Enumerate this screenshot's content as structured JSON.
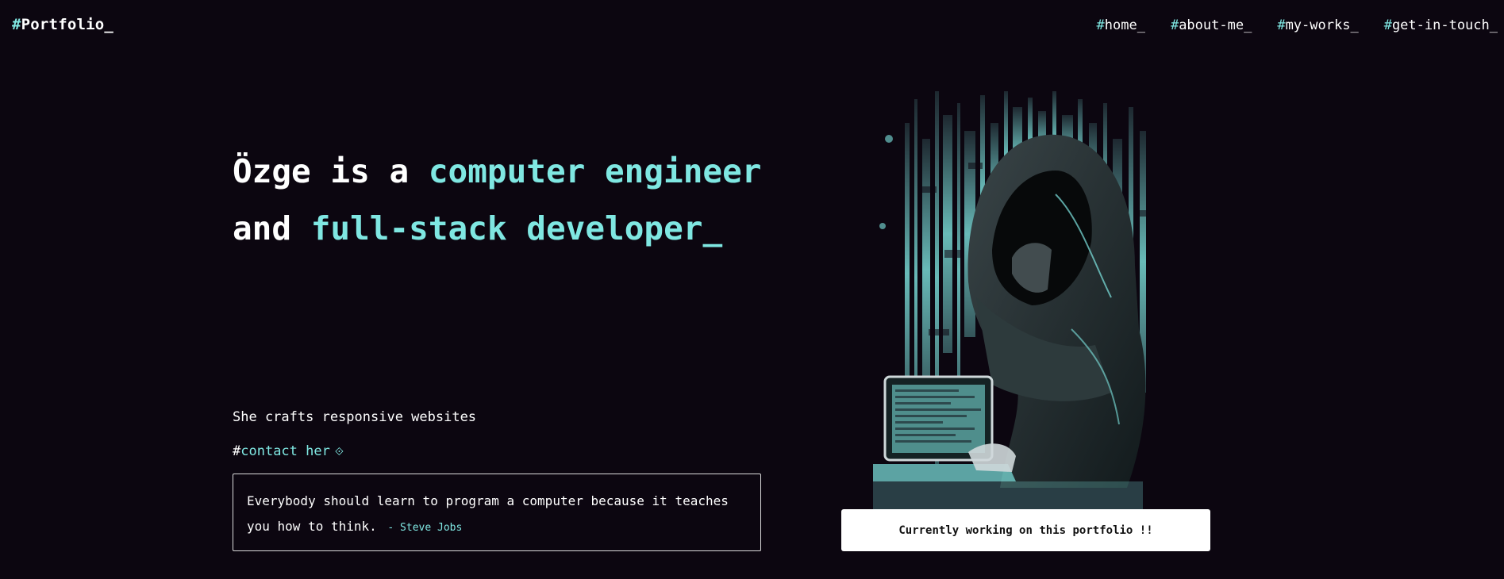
{
  "header": {
    "logo": {
      "hash": "#",
      "text": "Portfolio_"
    },
    "nav": [
      {
        "hash": "#",
        "label": "home_"
      },
      {
        "hash": "#",
        "label": "about-me_"
      },
      {
        "hash": "#",
        "label": "my-works_"
      },
      {
        "hash": "#",
        "label": "get-in-touch_"
      }
    ]
  },
  "hero": {
    "line1_plain": "Özge is a ",
    "line1_accent": "computer engineer",
    "line2_plain": "and ",
    "line2_accent": "full-stack developer",
    "line2_suffix": "_",
    "tagline": "She crafts responsive websites",
    "contact_hash": "#",
    "contact_label": "contact her",
    "contact_arrow": "⟐",
    "quote_text": "Everybody should learn to program a computer because it teaches you how to think.",
    "quote_author": "- Steve Jobs"
  },
  "status": {
    "text": "Currently working on this portfolio !!"
  },
  "colors": {
    "background": "#0c0610",
    "accent": "#7fe7e2",
    "text": "#ffffff"
  }
}
